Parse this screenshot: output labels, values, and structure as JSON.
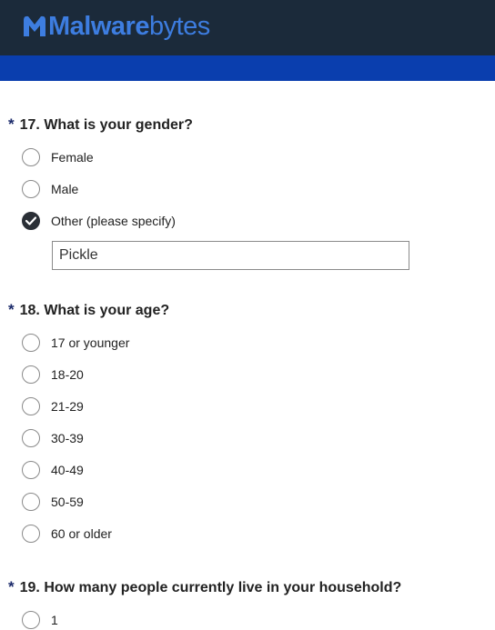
{
  "brand": {
    "bold": "Malware",
    "light": "bytes"
  },
  "questions": [
    {
      "required_mark": "*",
      "label": "17. What is your gender?",
      "options": [
        "Female",
        "Male",
        "Other (please specify)"
      ],
      "selected": "Other (please specify)",
      "other_value": "Pickle"
    },
    {
      "required_mark": "*",
      "label": "18. What is your age?",
      "options": [
        "17 or younger",
        "18-20",
        "21-29",
        "30-39",
        "40-49",
        "50-59",
        "60 or older"
      ],
      "selected": null
    },
    {
      "required_mark": "*",
      "label": "19. How many people currently live in your household?",
      "options": [
        "1"
      ],
      "selected": null
    }
  ],
  "colors": {
    "header": "#1b2a3a",
    "blue_bar": "#0a3eae",
    "brand": "#3d7de0",
    "checked": "#2a2f36"
  }
}
